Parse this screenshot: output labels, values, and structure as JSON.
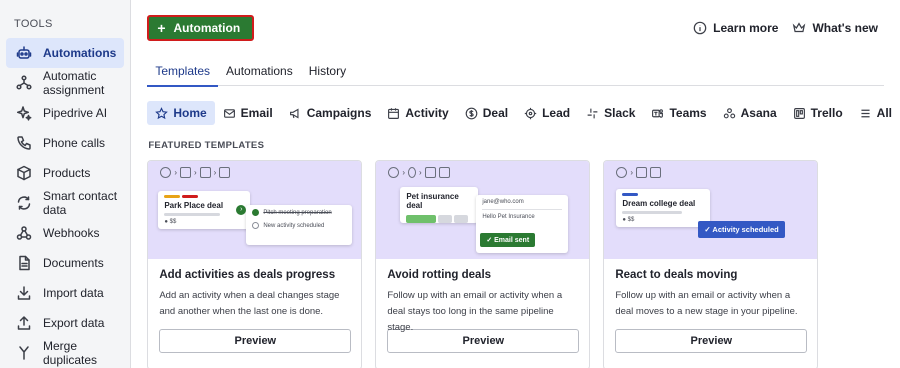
{
  "sidebar": {
    "heading": "TOOLS",
    "items": [
      {
        "label": "Automations",
        "icon": "robot-icon"
      },
      {
        "label": "Automatic assignment",
        "icon": "assign-icon"
      },
      {
        "label": "Pipedrive AI",
        "icon": "sparkle-icon"
      },
      {
        "label": "Phone calls",
        "icon": "phone-icon"
      },
      {
        "label": "Products",
        "icon": "box-icon"
      },
      {
        "label": "Smart contact data",
        "icon": "sync-icon"
      },
      {
        "label": "Webhooks",
        "icon": "webhook-icon"
      },
      {
        "label": "Documents",
        "icon": "document-icon"
      },
      {
        "label": "Import data",
        "icon": "import-icon"
      },
      {
        "label": "Export data",
        "icon": "export-icon"
      },
      {
        "label": "Merge duplicates",
        "icon": "merge-icon"
      }
    ]
  },
  "topbar": {
    "add_label": "Automation",
    "learn_more": "Learn more",
    "whats_new": "What's new"
  },
  "tabs": [
    "Templates",
    "Automations",
    "History"
  ],
  "filters": [
    "Home",
    "Email",
    "Campaigns",
    "Activity",
    "Deal",
    "Lead",
    "Slack",
    "Teams",
    "Asana",
    "Trello",
    "All"
  ],
  "section_label": "FEATURED TEMPLATES",
  "cards": [
    {
      "title": "Add activities as deals progress",
      "desc": "Add an activity when a deal changes stage and another when the last one is done.",
      "preview": "Preview",
      "art": {
        "deal": "Park Place deal",
        "amount": "$$",
        "item1": "Pitch meeting preparation",
        "item2": "New activity scheduled"
      }
    },
    {
      "title": "Avoid rotting deals",
      "desc": "Follow up with an email or activity when a deal stays too long in the same pipeline stage.",
      "preview": "Preview",
      "art": {
        "deal": "Pet insurance deal",
        "email_to": "jane@who.com",
        "email_subject": "Hello Pet Insurance",
        "button": "Email sent"
      }
    },
    {
      "title": "React to deals moving",
      "desc": "Follow up with an email or activity when a deal moves to a new stage in your pipeline.",
      "preview": "Preview",
      "art": {
        "deal": "Dream college deal",
        "amount": "$$",
        "badge": "Activity scheduled"
      }
    }
  ],
  "colors": {
    "accent": "#3358c4",
    "add_button": "#2b7a32",
    "art_bg": "#e3ddfb",
    "active_bg": "#dde6fb"
  }
}
